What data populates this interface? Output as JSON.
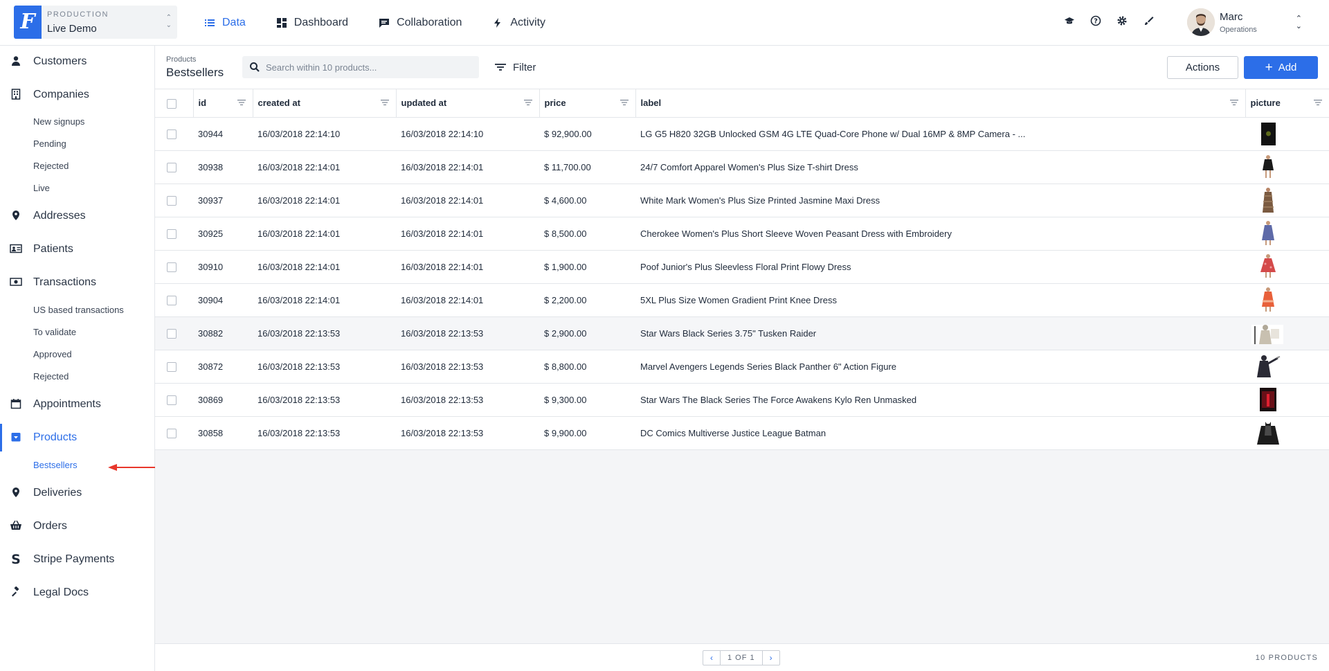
{
  "project": {
    "env": "PRODUCTION",
    "name": "Live Demo",
    "logo_letter": "F"
  },
  "nav": [
    {
      "label": "Data",
      "icon": "list-icon",
      "active": true
    },
    {
      "label": "Dashboard",
      "icon": "dashboard-icon"
    },
    {
      "label": "Collaboration",
      "icon": "chat-icon"
    },
    {
      "label": "Activity",
      "icon": "bolt-icon"
    }
  ],
  "user": {
    "name": "Marc",
    "role": "Operations"
  },
  "sidebar": {
    "items": [
      {
        "label": "Customers"
      },
      {
        "label": "Companies"
      },
      {
        "label": "Addresses"
      },
      {
        "label": "Patients"
      },
      {
        "label": "Transactions"
      },
      {
        "label": "Appointments"
      },
      {
        "label": "Products"
      },
      {
        "label": "Deliveries"
      },
      {
        "label": "Orders"
      },
      {
        "label": "Stripe Payments"
      },
      {
        "label": "Legal Docs"
      }
    ],
    "companies_segments": [
      "New signups",
      "Pending",
      "Rejected",
      "Live"
    ],
    "transactions_segments": [
      "US based transactions",
      "To validate",
      "Approved",
      "Rejected"
    ],
    "products_segments": [
      "Bestsellers"
    ]
  },
  "header": {
    "breadcrumb": "Products",
    "title": "Bestsellers",
    "search_placeholder": "Search within 10 products...",
    "filter_label": "Filter",
    "actions_label": "Actions",
    "add_label": "Add"
  },
  "table": {
    "columns": [
      "id",
      "created at",
      "updated at",
      "price",
      "label",
      "picture"
    ],
    "rows": [
      {
        "id": "30944",
        "created": "16/03/2018 22:14:10",
        "updated": "16/03/2018 22:14:10",
        "price": "$ 92,900.00",
        "label": "LG G5 H820 32GB Unlocked GSM 4G LTE Quad-Core Phone w/ Dual 16MP & 8MP Camera - ...",
        "picture": "phone"
      },
      {
        "id": "30938",
        "created": "16/03/2018 22:14:01",
        "updated": "16/03/2018 22:14:01",
        "price": "$ 11,700.00",
        "label": "24/7 Comfort Apparel Women's Plus Size T-shirt Dress",
        "picture": "black-dress"
      },
      {
        "id": "30937",
        "created": "16/03/2018 22:14:01",
        "updated": "16/03/2018 22:14:01",
        "price": "$ 4,600.00",
        "label": "White Mark Women's Plus Size Printed Jasmine Maxi Dress",
        "picture": "brown-dress"
      },
      {
        "id": "30925",
        "created": "16/03/2018 22:14:01",
        "updated": "16/03/2018 22:14:01",
        "price": "$ 8,500.00",
        "label": "Cherokee Women's Plus Short Sleeve Woven Peasant Dress with Embroidery",
        "picture": "blue-dress"
      },
      {
        "id": "30910",
        "created": "16/03/2018 22:14:01",
        "updated": "16/03/2018 22:14:01",
        "price": "$ 1,900.00",
        "label": "Poof Junior's Plus Sleevless Floral Print Flowy Dress",
        "picture": "red-dress"
      },
      {
        "id": "30904",
        "created": "16/03/2018 22:14:01",
        "updated": "16/03/2018 22:14:01",
        "price": "$ 2,200.00",
        "label": "5XL Plus Size Women Gradient Print Knee Dress",
        "picture": "orange-dress"
      },
      {
        "id": "30882",
        "created": "16/03/2018 22:13:53",
        "updated": "16/03/2018 22:13:53",
        "price": "$ 2,900.00",
        "label": "Star Wars Black Series 3.75\" Tusken Raider",
        "picture": "tusken-figure"
      },
      {
        "id": "30872",
        "created": "16/03/2018 22:13:53",
        "updated": "16/03/2018 22:13:53",
        "price": "$ 8,800.00",
        "label": "Marvel Avengers Legends Series Black Panther 6\" Action Figure",
        "picture": "panther-figure"
      },
      {
        "id": "30869",
        "created": "16/03/2018 22:13:53",
        "updated": "16/03/2018 22:13:53",
        "price": "$ 9,300.00",
        "label": "Star Wars The Black Series The Force Awakens Kylo Ren Unmasked",
        "picture": "kylo-box"
      },
      {
        "id": "30858",
        "created": "16/03/2018 22:13:53",
        "updated": "16/03/2018 22:13:53",
        "price": "$ 9,900.00",
        "label": "DC Comics Multiverse Justice League Batman",
        "picture": "batman-figure"
      }
    ]
  },
  "footer": {
    "page_label": "1 OF 1",
    "count_label": "10 PRODUCTS"
  },
  "colors": {
    "accent": "#2c6ee8",
    "annotation_arrow": "#e8372c"
  }
}
